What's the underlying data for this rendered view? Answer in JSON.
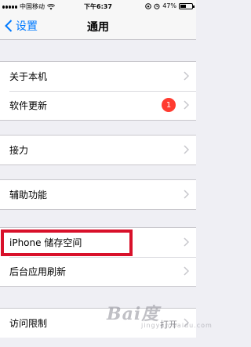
{
  "status_bar": {
    "carrier": "中国移动",
    "time": "下午6:37",
    "battery": "47%",
    "battery_level": 0.47
  },
  "nav": {
    "back_label": "设置",
    "title": "通用"
  },
  "groups": [
    {
      "rows": [
        {
          "label": "关于本机"
        },
        {
          "label": "软件更新",
          "badge": "1"
        }
      ]
    },
    {
      "rows": [
        {
          "label": "接力"
        }
      ]
    },
    {
      "rows": [
        {
          "label": "辅助功能"
        }
      ]
    },
    {
      "rows": [
        {
          "label": "iPhone 储存空间"
        },
        {
          "label": "后台应用刷新"
        }
      ]
    },
    {
      "rows": [
        {
          "label": "访问限制",
          "value": "打开"
        }
      ]
    }
  ],
  "watermark": {
    "logo": "Bai度",
    "subtitle": "jingyan.baidu.com"
  },
  "colors": {
    "accent": "#007aff",
    "badge": "#ff3b30",
    "highlight": "#d8102a",
    "background": "#efeff4"
  }
}
